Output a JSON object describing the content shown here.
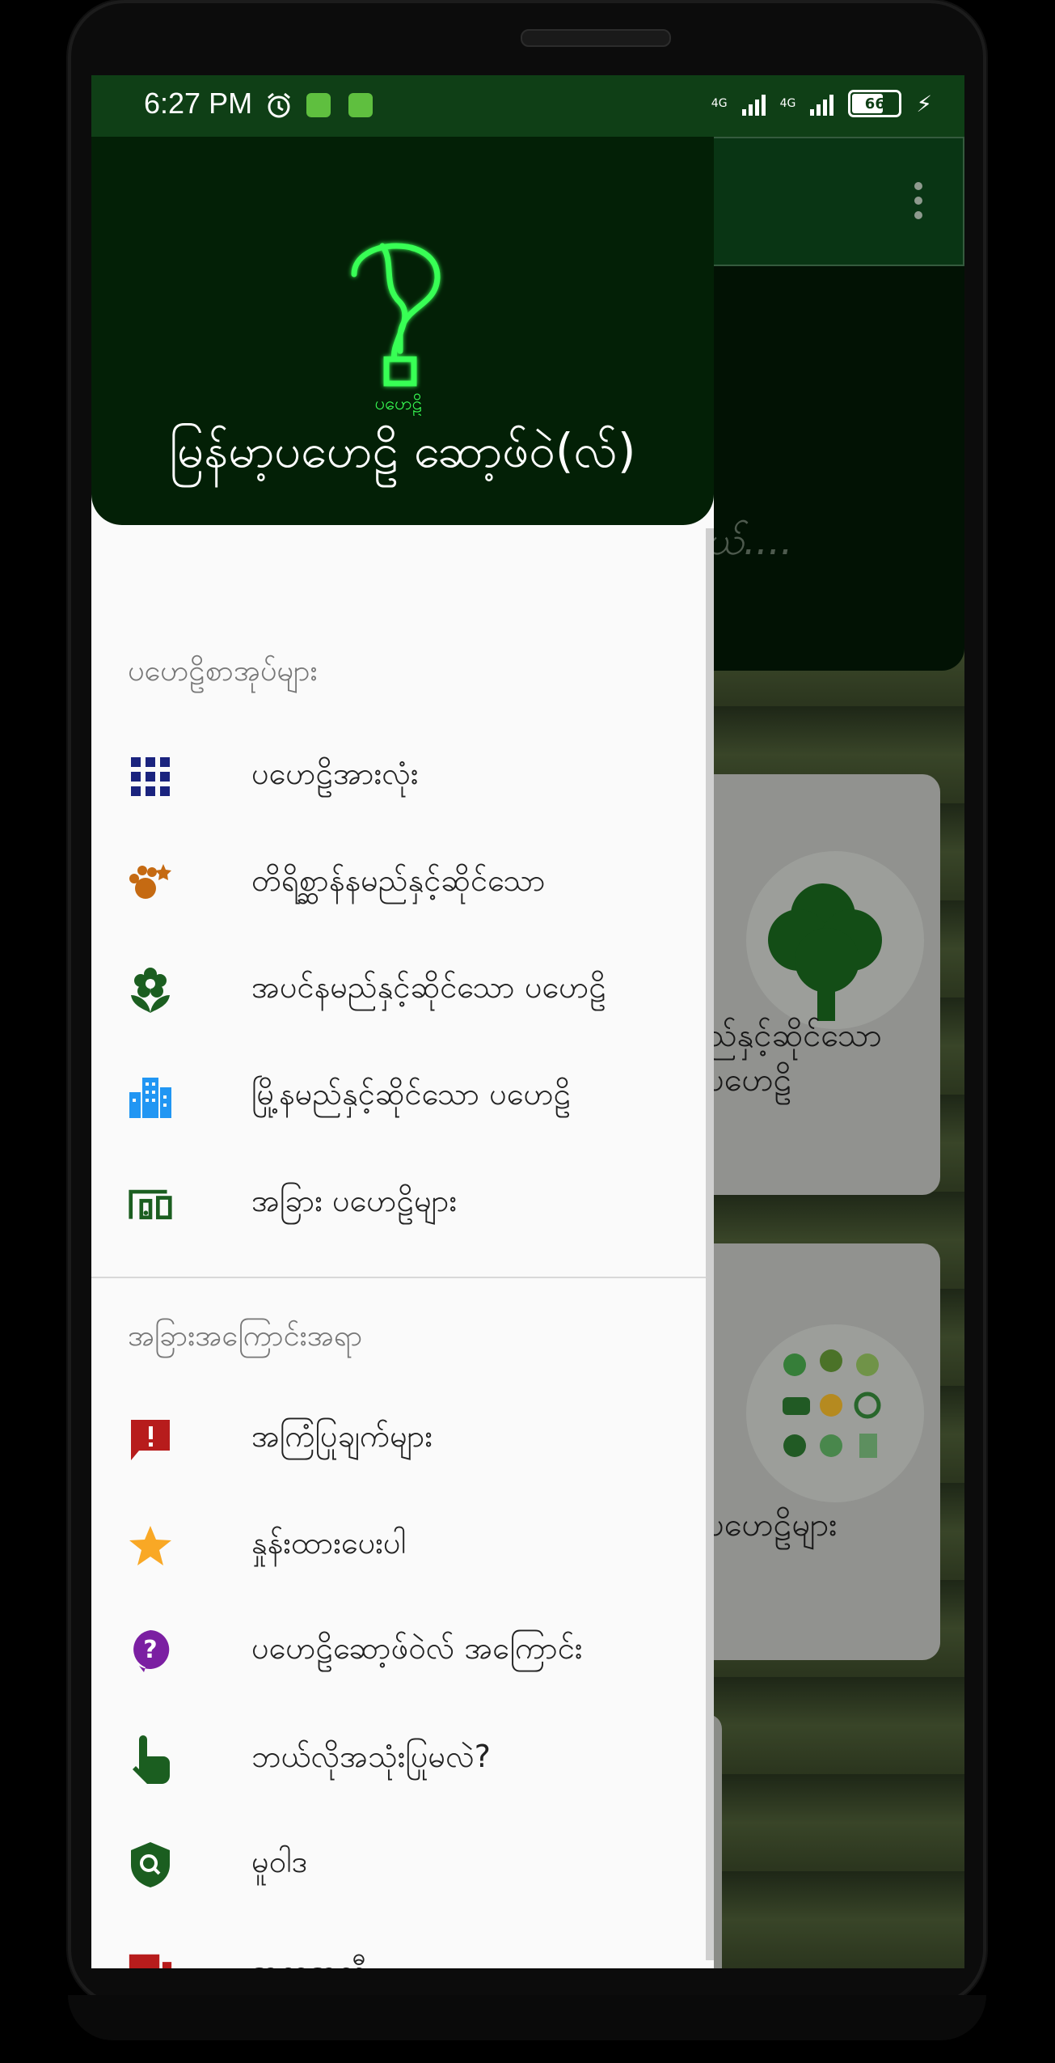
{
  "status": {
    "time": "6:27 PM",
    "net1": "4G",
    "net2": "4G",
    "battery": "66"
  },
  "app_title": "မြန်မာ့ပဟေဠိ ဆော့ဖ်ဝဲ(လ်)",
  "logo_caption": "ပဟေဠိ",
  "background": {
    "hero_text": "ယ်....",
    "card1_text_line1": "ည်နှင့်ဆိုင်သော",
    "card1_text_line2": "ပဟေဠိ",
    "card2_text": "ပဟေဠိများ"
  },
  "drawer": {
    "section1": "ပဟေဠိစာအုပ်များ",
    "section1_items": [
      {
        "label": "ပဟေဠိအားလုံး",
        "icon": "grid-icon",
        "color": "#1a237e"
      },
      {
        "label": "တိရိစ္ဆာန်နမည်နှင့်ဆိုင်သော",
        "icon": "pets-icon",
        "color": "#c56a12"
      },
      {
        "label": "အပင်နမည်နှင့်ဆိုင်သော ပဟေဠိ",
        "icon": "flower-icon",
        "color": "#1b5e20"
      },
      {
        "label": "မြို့နမည်နှင့်ဆိုင်သော ပဟေဠိ",
        "icon": "city-icon",
        "color": "#2196f3"
      },
      {
        "label": "အခြား ပဟေဠိများ",
        "icon": "devices-icon",
        "color": "#1b5e20"
      }
    ],
    "section2": "အခြားအကြောင်းအရာ",
    "section2_items": [
      {
        "label": "အကြံပြုချက်များ",
        "icon": "feedback-icon",
        "color": "#b71c1c"
      },
      {
        "label": "နှုန်းထားပေးပါ",
        "icon": "star-icon",
        "color": "#f9a825"
      },
      {
        "label": "ပဟေဠိဆော့ဖ်ဝဲလ် အကြောင်း",
        "icon": "help-icon",
        "color": "#7b1fa2"
      },
      {
        "label": "ဘယ်လိုအသုံးပြုမလဲ?",
        "icon": "touch-icon",
        "color": "#1b5e20"
      },
      {
        "label": "မူဝါဒ",
        "icon": "privacy-shield-icon",
        "color": "#1b5e20"
      },
      {
        "label": "အကူအညီ",
        "icon": "forum-icon",
        "color": "#b71c1c"
      }
    ]
  }
}
